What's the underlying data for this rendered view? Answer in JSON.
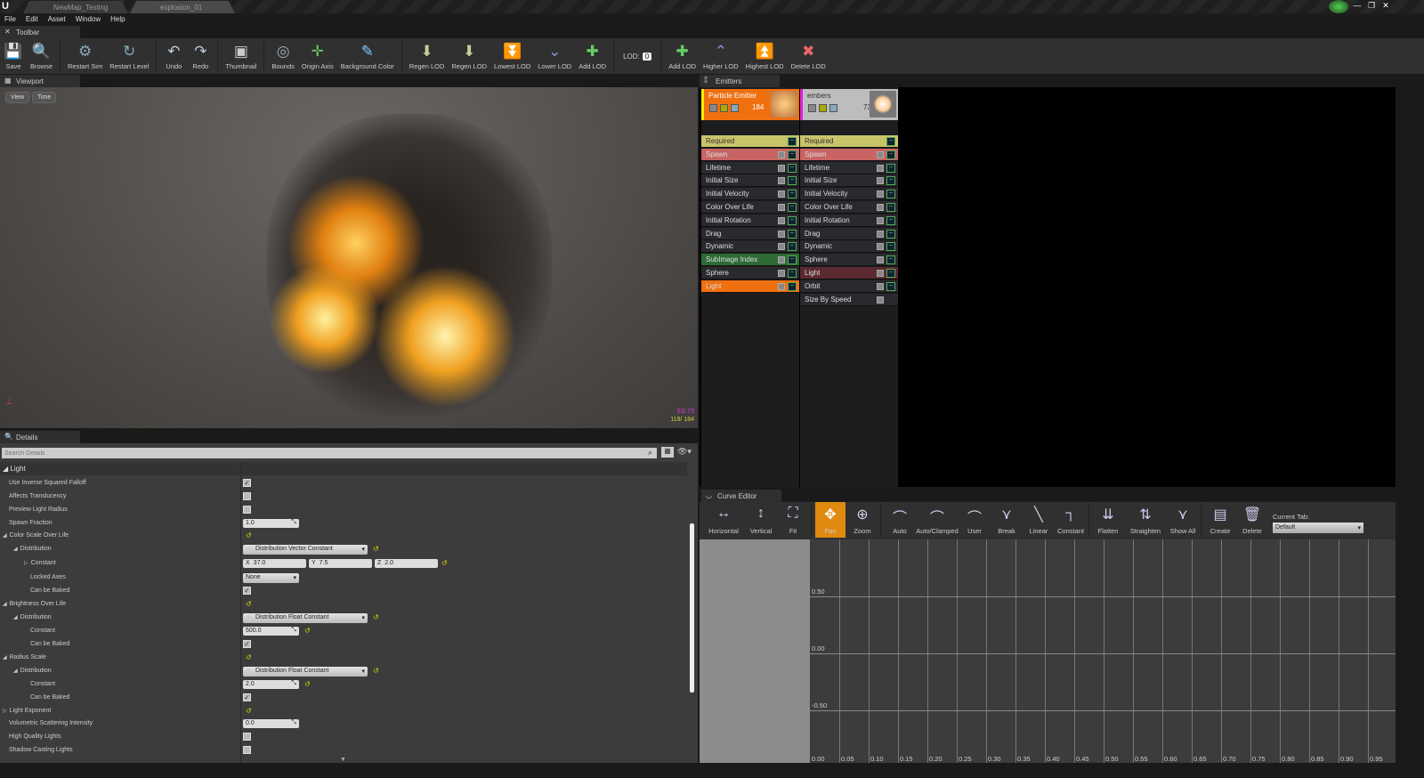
{
  "window": {
    "tabs": [
      "NewMap_Testing",
      "explosion_01"
    ],
    "controls": [
      "—",
      "❐",
      "✕"
    ]
  },
  "menu": [
    "File",
    "Edit",
    "Asset",
    "Window",
    "Help"
  ],
  "panels": {
    "toolbar": "Toolbar",
    "viewport": "Viewport",
    "emitters": "Emitters",
    "details": "Details",
    "curve": "Curve Editor"
  },
  "toolbar": {
    "buttons": [
      {
        "label": "Save",
        "icon": "💾",
        "color": "#9bc"
      },
      {
        "label": "Browse",
        "icon": "🔍",
        "color": "#ccc"
      },
      {
        "sep": true
      },
      {
        "label": "Restart Sim",
        "icon": "⚙",
        "color": "#8ab"
      },
      {
        "label": "Restart Level",
        "icon": "↻",
        "color": "#8ab"
      },
      {
        "sep": true
      },
      {
        "label": "Undo",
        "icon": "↶",
        "color": "#bcd"
      },
      {
        "label": "Redo",
        "icon": "↷",
        "color": "#bcd"
      },
      {
        "sep": true
      },
      {
        "label": "Thumbnail",
        "icon": "▣",
        "color": "#ccc"
      },
      {
        "sep": true
      },
      {
        "label": "Bounds",
        "icon": "◎",
        "color": "#9ab"
      },
      {
        "label": "Origin Axis",
        "icon": "✛",
        "color": "#6c6"
      },
      {
        "label": "Background Color",
        "icon": "✎",
        "color": "#7cf"
      },
      {
        "sep": true
      },
      {
        "label": "Regen LOD",
        "icon": "⬇",
        "color": "#cc9"
      },
      {
        "label": "Regen LOD",
        "icon": "⬇",
        "color": "#cc9"
      },
      {
        "label": "Lowest LOD",
        "icon": "⏬",
        "color": "#89d"
      },
      {
        "label": "Lower LOD",
        "icon": "⌄",
        "color": "#89d"
      },
      {
        "label": "Add LOD",
        "icon": "✚",
        "color": "#6c6"
      },
      {
        "sep": true
      }
    ],
    "lod_label": "LOD:",
    "lod_value": "0",
    "buttons2": [
      {
        "label": "Add LOD",
        "icon": "✚",
        "color": "#6c6"
      },
      {
        "label": "Higher LOD",
        "icon": "⌃",
        "color": "#89d"
      },
      {
        "label": "Highest LOD",
        "icon": "⏫",
        "color": "#89d"
      },
      {
        "label": "Delete LOD",
        "icon": "✖",
        "color": "#e66"
      }
    ]
  },
  "viewport": {
    "view_button": "View",
    "time_button": "Time",
    "stats_emitter2": "53/ 73",
    "stats_emitter1": "118/ 184"
  },
  "emitters": [
    {
      "name": "Particle Emitter",
      "count": "184",
      "head_color": "#f07010",
      "marker": "#ffee00",
      "rows": [
        {
          "label": "Required",
          "color": "#c8c46a",
          "text": "#333",
          "cb": false
        },
        {
          "label": "Spawn",
          "color": "#c86464"
        },
        {
          "label": "Lifetime"
        },
        {
          "label": "Initial Size"
        },
        {
          "label": "Initial Velocity"
        },
        {
          "label": "Color Over Life"
        },
        {
          "label": "Initial Rotation"
        },
        {
          "label": "Drag"
        },
        {
          "label": "Dynamic"
        },
        {
          "label": "SubImage Index",
          "color": "#2d6a34"
        },
        {
          "label": "Sphere"
        },
        {
          "label": "Light",
          "color": "#f07010"
        }
      ]
    },
    {
      "name": "embers",
      "count": "73",
      "head_color": "#bdbdbd",
      "marker": "#e020e0",
      "rows": [
        {
          "label": "Required",
          "color": "#c8c46a",
          "text": "#333",
          "cb": false
        },
        {
          "label": "Spawn",
          "color": "#c86464"
        },
        {
          "label": "Lifetime"
        },
        {
          "label": "Initial Size"
        },
        {
          "label": "Initial Velocity"
        },
        {
          "label": "Color Over Life"
        },
        {
          "label": "Initial Rotation"
        },
        {
          "label": "Drag"
        },
        {
          "label": "Dynamic"
        },
        {
          "label": "Sphere"
        },
        {
          "label": "Light",
          "color": "#5a2a30"
        },
        {
          "label": "Orbit"
        },
        {
          "label": "Size By Speed",
          "nocurve": true
        }
      ]
    }
  ],
  "details": {
    "search_placeholder": "Search Details",
    "section": "Light",
    "rows": [
      {
        "label": "Use Inverse Squared Falloff",
        "indent": 1,
        "type": "check",
        "checked": true
      },
      {
        "label": "Affects Translucency",
        "indent": 1,
        "type": "check",
        "checked": false
      },
      {
        "label": "Preview Light Radius",
        "indent": 1,
        "type": "check",
        "checked": false
      },
      {
        "label": "Spawn Fraction",
        "indent": 1,
        "type": "num",
        "value": "1.0"
      },
      {
        "label": "Color Scale Over Life",
        "indent": 1,
        "arrow": "◢",
        "type": "reset"
      },
      {
        "label": "Distribution",
        "indent": 2,
        "arrow": "◢",
        "type": "dd",
        "value": "Distribution Vector Constant"
      },
      {
        "label": "Constant",
        "indent": 3,
        "arrow": "▷",
        "type": "vec",
        "x": "37.0",
        "y": "7.5",
        "z": "2.0"
      },
      {
        "label": "Locked Axes",
        "indent": 3,
        "type": "select",
        "value": "None"
      },
      {
        "label": "Can be Baked",
        "indent": 3,
        "type": "check",
        "checked": true
      },
      {
        "label": "Brightness Over Life",
        "indent": 1,
        "arrow": "◢",
        "type": "reset"
      },
      {
        "label": "Distribution",
        "indent": 2,
        "arrow": "◢",
        "type": "dd",
        "value": "Distribution Float Constant"
      },
      {
        "label": "Constant",
        "indent": 3,
        "type": "num",
        "value": "500.0",
        "reset": true
      },
      {
        "label": "Can be Baked",
        "indent": 3,
        "type": "check",
        "checked": true
      },
      {
        "label": "Radius Scale",
        "indent": 1,
        "arrow": "◢",
        "type": "reset"
      },
      {
        "label": "Distribution",
        "indent": 2,
        "arrow": "◢",
        "type": "dd",
        "value": "Distribution Float Constant"
      },
      {
        "label": "Constant",
        "indent": 3,
        "type": "num",
        "value": "2.0",
        "reset": true
      },
      {
        "label": "Can be Baked",
        "indent": 3,
        "type": "check",
        "checked": true
      },
      {
        "label": "Light Exponent",
        "indent": 1,
        "arrow": "▷",
        "type": "reset"
      },
      {
        "label": "Volumetric Scattering Intensity",
        "indent": 1,
        "type": "num",
        "value": "0.0"
      },
      {
        "label": "High Quality Lights",
        "indent": 1,
        "type": "check",
        "checked": false
      },
      {
        "label": "Shadow Casting Lights",
        "indent": 1,
        "type": "check",
        "checked": false
      }
    ]
  },
  "curve_editor": {
    "tools": [
      {
        "label": "Horizontal",
        "icon": "↔"
      },
      {
        "label": "Vertical",
        "icon": "↕"
      },
      {
        "label": "Fit",
        "icon": "⛶"
      },
      {
        "sep": true
      },
      {
        "label": "Pan",
        "icon": "✥",
        "active": true
      },
      {
        "label": "Zoom",
        "icon": "⊕"
      },
      {
        "sep": true
      },
      {
        "label": "Auto",
        "icon": "⌒"
      },
      {
        "label": "Auto/Clamped",
        "icon": "⌒"
      },
      {
        "label": "User",
        "icon": "⌒"
      },
      {
        "label": "Break",
        "icon": "⋎"
      },
      {
        "label": "Linear",
        "icon": "╲"
      },
      {
        "label": "Constant",
        "icon": "┐"
      },
      {
        "sep": true
      },
      {
        "label": "Flatten",
        "icon": "⇊"
      },
      {
        "label": "Straighten",
        "icon": "⇅"
      },
      {
        "label": "Show All",
        "icon": "⋎"
      },
      {
        "sep": true
      },
      {
        "label": "Create",
        "icon": "▤"
      },
      {
        "label": "Delete",
        "icon": "🗑"
      }
    ],
    "current_tab_label": "Current Tab:",
    "current_tab_value": "Default"
  },
  "chart_data": {
    "type": "line",
    "x_ticks": [
      "0.00",
      "0.05",
      "0.10",
      "0.15",
      "0.20",
      "0.25",
      "0.30",
      "0.35",
      "0.40",
      "0.45",
      "0.50",
      "0.55",
      "0.60",
      "0.65",
      "0.70",
      "0.75",
      "0.80",
      "0.85",
      "0.90",
      "0.95"
    ],
    "y_ticks": [
      "0.50",
      "0.00",
      "-0.50"
    ],
    "series": []
  }
}
